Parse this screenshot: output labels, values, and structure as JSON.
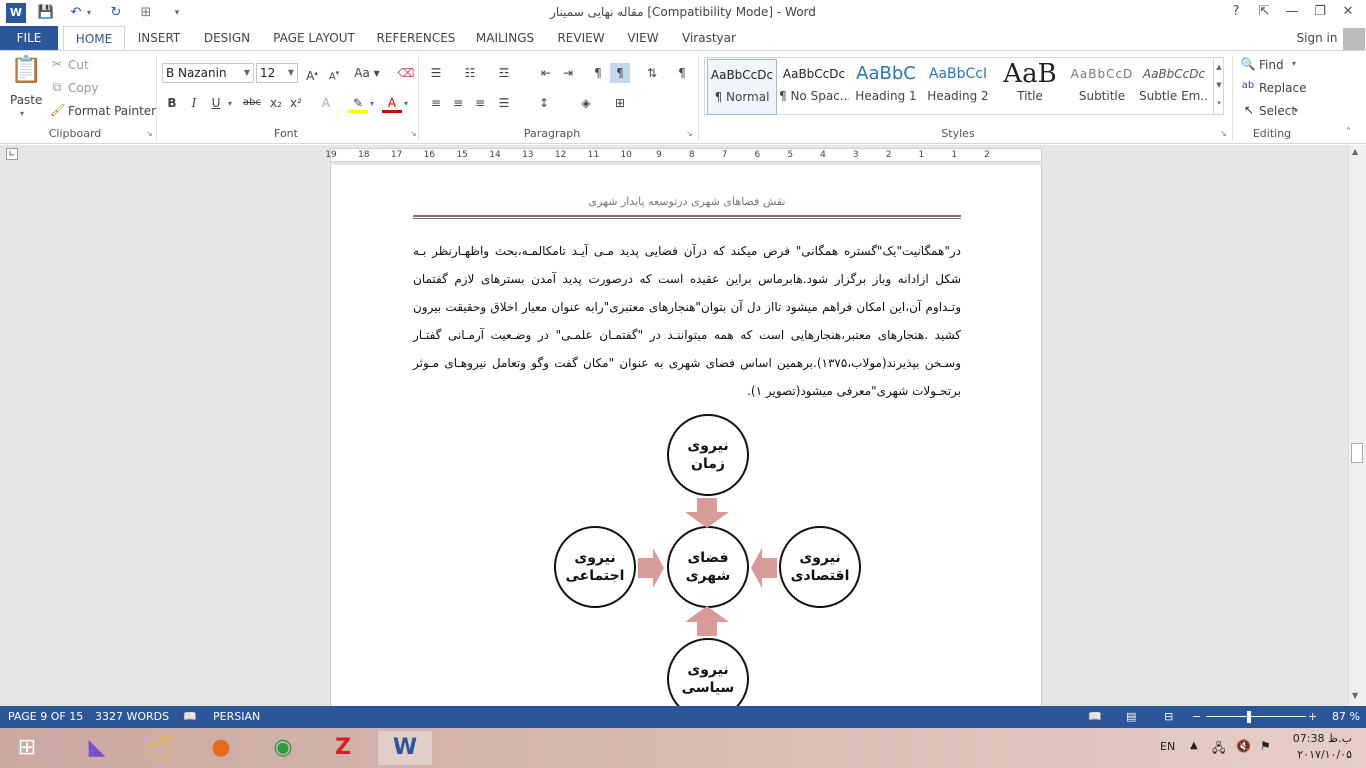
{
  "window": {
    "title": "مقاله نهایی سمینار [Compatibility Mode] - Word"
  },
  "title_controls": {
    "help": "?",
    "ribbon_display": "⇱",
    "minimize": "—",
    "restore": "❐",
    "close": "✕"
  },
  "tabs": [
    "FILE",
    "HOME",
    "INSERT",
    "DESIGN",
    "PAGE LAYOUT",
    "REFERENCES",
    "MAILINGS",
    "REVIEW",
    "VIEW",
    "Virastyar"
  ],
  "account": {
    "sign_in": "Sign in"
  },
  "clipboard": {
    "paste": "Paste",
    "cut": "Cut",
    "copy": "Copy",
    "format_painter": "Format Painter",
    "label": "Clipboard"
  },
  "font": {
    "name": "B Nazanin",
    "size": "12",
    "label": "Font",
    "bold": "B",
    "italic": "I",
    "underline": "U",
    "strike": "abc",
    "subscript": "x₂",
    "superscript": "x²"
  },
  "paragraph": {
    "label": "Paragraph"
  },
  "styles": {
    "label": "Styles",
    "items": [
      {
        "sample": "AaBbCcDc",
        "name": "¶ Normal"
      },
      {
        "sample": "AaBbCcDc",
        "name": "¶ No Spac..."
      },
      {
        "sample": "AaBbC",
        "name": "Heading 1"
      },
      {
        "sample": "AaBbCcI",
        "name": "Heading 2"
      },
      {
        "sample": "AaB",
        "name": "Title"
      },
      {
        "sample": "AaBbCcD",
        "name": "Subtitle"
      },
      {
        "sample": "AaBbCcDc",
        "name": "Subtle Em..."
      }
    ]
  },
  "editing": {
    "find": "Find",
    "replace": "Replace",
    "select": "Select",
    "label": "Editing"
  },
  "ruler": {
    "numbers": [
      "19",
      "18",
      "17",
      "16",
      "15",
      "14",
      "13",
      "12",
      "11",
      "10",
      "9",
      "8",
      "7",
      "6",
      "5",
      "4",
      "3",
      "2",
      "1",
      "1",
      "2"
    ]
  },
  "document": {
    "header": "نقش فضاهای شهری درتوسعه پایدار شهری",
    "body": "در\"همگانیت\"یک\"گستره همگانی\" فرض میکند که درآن فضایی پدید مـی آیـد تامکالمـه،بحث واظهـارنظر بـه شکل ازادانه وباز برگزار شود.هابرماس براین عقیده است که درصورت پدید آمدن بسترهای لازم گفتمان وتـداوم آن،این امکان فراهم میشود تااز دل آن بتوان\"هنجارهای معتبری\"رابه عنوان معیار اخلاق وحقیقت بیرون کشید .هنجارهای معتبر،هنجارهایی است که همه میتواننـد در \"گفتمـان علمـی\" در وضـعیت آرمـانی گفتـار وسـخن بپذیرند(مولاب،۱۳۷۵).برهمین اساس فضای شهری به عنوان \"مکان گفت وگو وتعامل نیروهـای مـوثر برتحـولات شهری\"معرفی میشود(تصویر ۱).",
    "diagram": {
      "top": [
        "نیروی",
        "زمان"
      ],
      "center": [
        "فضای",
        "شهری"
      ],
      "left": [
        "نیروی",
        "اجتماعی"
      ],
      "right": [
        "نیروی",
        "اقتصادی"
      ],
      "bottom": [
        "نیروی",
        "سیاسی"
      ]
    }
  },
  "status": {
    "page": "PAGE 9 OF 15",
    "words": "3327 WORDS",
    "language": "PERSIAN",
    "zoom": "87 %"
  },
  "taskbar": {
    "lang": "EN",
    "time": "07:38 ب.ظ",
    "date": "۲۰۱۷/۱۰/۰۵"
  }
}
